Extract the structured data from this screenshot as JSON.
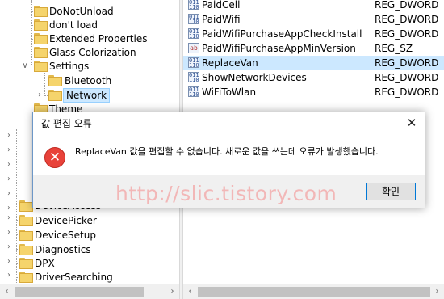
{
  "tree": {
    "items": [
      {
        "label": "DoNotUnload"
      },
      {
        "label": "don't load"
      },
      {
        "label": "Extended Properties"
      },
      {
        "label": "Glass Colorization"
      },
      {
        "label": "Settings",
        "expander": "∨"
      },
      {
        "label": "Bluetooth"
      },
      {
        "label": "Network",
        "expander": "›"
      },
      {
        "label": "Theme"
      },
      {
        "label": "DeviceAccess"
      },
      {
        "label": "DevicePicker"
      },
      {
        "label": "DeviceSetup"
      },
      {
        "label": "Diagnostics"
      },
      {
        "label": "DPX"
      },
      {
        "label": "DriverSearching"
      }
    ],
    "left_expanders": [
      "›",
      "›",
      "›",
      "›",
      "›",
      "›",
      "›",
      "›",
      "›",
      "›",
      "›"
    ]
  },
  "values": {
    "rows": [
      {
        "icon": "reg-binary-icon",
        "name": "PaidCell",
        "type": "REG_DWORD"
      },
      {
        "icon": "reg-binary-icon",
        "name": "PaidWifi",
        "type": "REG_DWORD"
      },
      {
        "icon": "reg-binary-icon",
        "name": "PaidWifiPurchaseAppCheckInstall",
        "type": "REG_DWORD"
      },
      {
        "icon": "reg-string-icon",
        "name": "PaidWifiPurchaseAppMinVersion",
        "type": "REG_SZ"
      },
      {
        "icon": "reg-binary-icon",
        "name": "ReplaceVan",
        "type": "REG_DWORD"
      },
      {
        "icon": "reg-binary-icon",
        "name": "ShowNetworkDevices",
        "type": "REG_DWORD"
      },
      {
        "icon": "reg-binary-icon",
        "name": "WiFiToWlan",
        "type": "REG_DWORD"
      }
    ]
  },
  "dialog": {
    "title": "값 편집 오류",
    "close": "✕",
    "icon_glyph": "✕",
    "message": "ReplaceVan 값을 편집할 수 없습니다. 새로운 값을 쓰는데 오류가 발생했습니다.",
    "ok_label": "확인"
  },
  "watermark": "http://slic.tistory.com",
  "scrollbar": {
    "left_arrow": "‹",
    "right_arrow": "›"
  },
  "colors": {
    "selection": "#cce8ff",
    "error_red": "#e8423a",
    "dialog_border": "#6d97c7",
    "watermark": "#f2b7b7"
  }
}
